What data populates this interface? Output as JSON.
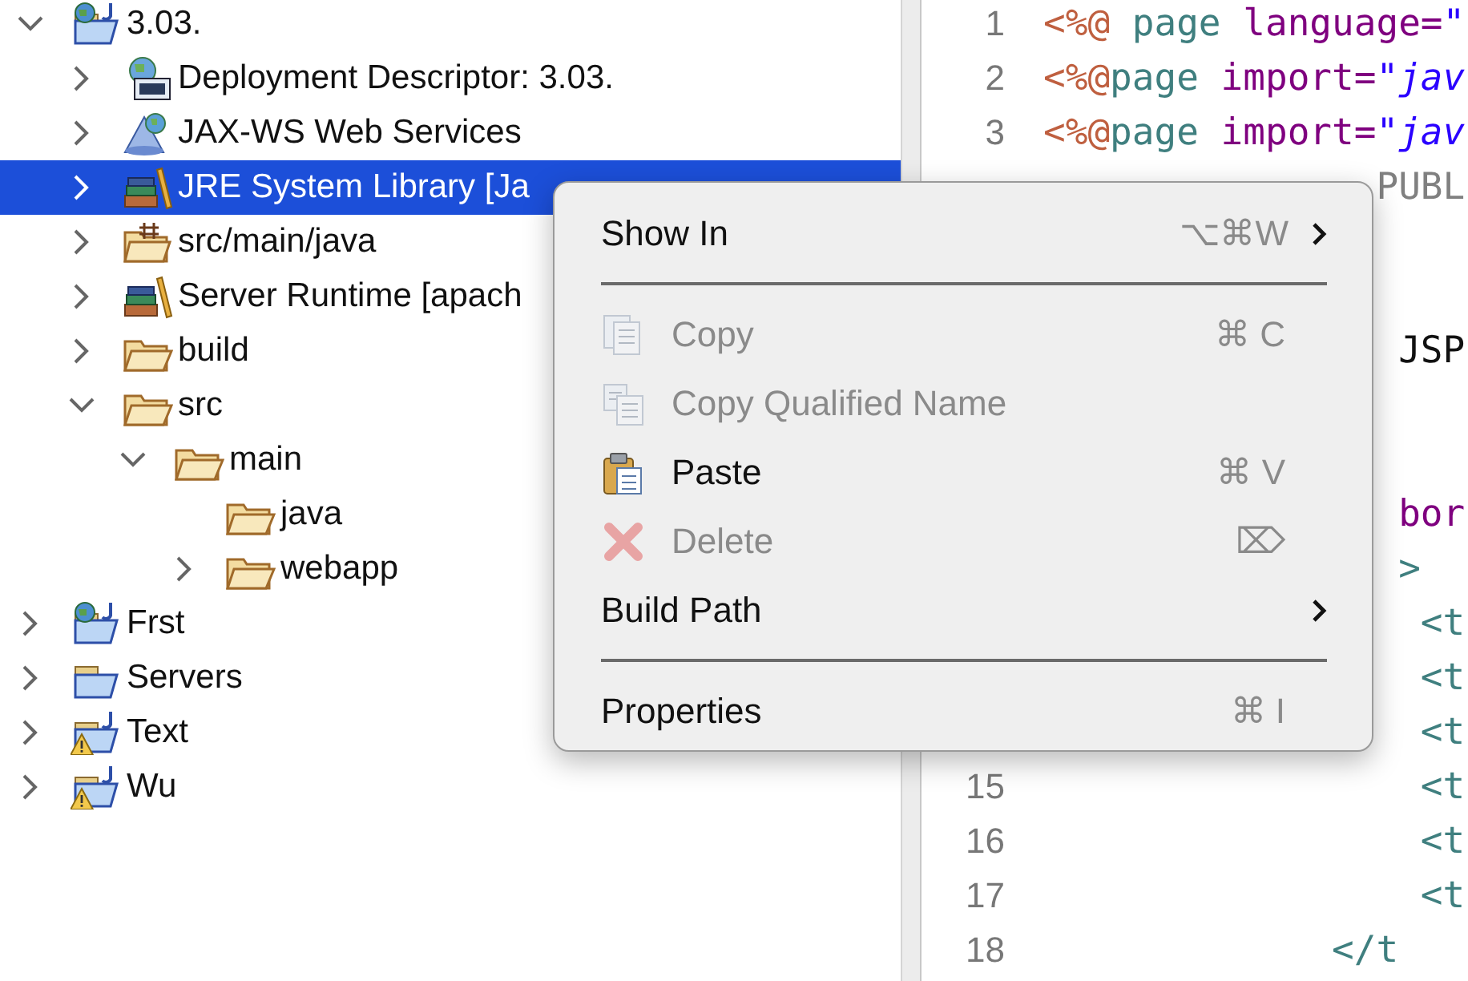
{
  "tree": [
    {
      "label": "3.03.",
      "kind": "web-project",
      "expandable": true,
      "expanded": true,
      "selected": false,
      "children": [
        {
          "label": "Deployment Descriptor: 3.03.",
          "kind": "descriptor",
          "expandable": true,
          "expanded": false,
          "selected": false
        },
        {
          "label": "JAX-WS Web Services",
          "kind": "webservice",
          "expandable": true,
          "expanded": false,
          "selected": false
        },
        {
          "label": "JRE System Library [Ja",
          "kind": "library",
          "expandable": true,
          "expanded": false,
          "selected": true
        },
        {
          "label": "src/main/java",
          "kind": "package-folder",
          "expandable": true,
          "expanded": false,
          "selected": false
        },
        {
          "label": "Server Runtime [apach",
          "kind": "library",
          "expandable": true,
          "expanded": false,
          "selected": false
        },
        {
          "label": "build",
          "kind": "folder",
          "expandable": true,
          "expanded": false,
          "selected": false
        },
        {
          "label": "src",
          "kind": "folder",
          "expandable": true,
          "expanded": true,
          "selected": false,
          "children": [
            {
              "label": "main",
              "kind": "folder",
              "expandable": true,
              "expanded": true,
              "selected": false,
              "children": [
                {
                  "label": "java",
                  "kind": "folder",
                  "expandable": false,
                  "selected": false
                },
                {
                  "label": "webapp",
                  "kind": "folder",
                  "expandable": true,
                  "expanded": false,
                  "selected": false
                }
              ]
            }
          ]
        }
      ]
    },
    {
      "label": "Frst",
      "kind": "web-project",
      "expandable": true,
      "expanded": false,
      "selected": false
    },
    {
      "label": "Servers",
      "kind": "folder-project",
      "expandable": true,
      "expanded": false,
      "selected": false
    },
    {
      "label": "Text",
      "kind": "warning-project",
      "expandable": true,
      "expanded": false,
      "selected": false
    },
    {
      "label": "Wu",
      "kind": "warning-project",
      "expandable": true,
      "expanded": false,
      "selected": false
    }
  ],
  "editor": {
    "lines": [
      {
        "covered": false,
        "number": "1",
        "code": [
          {
            "text": "<%@",
            "kind": "directive"
          },
          {
            "text": " page",
            "kind": "tag"
          },
          {
            "text": " language=",
            "kind": "attr"
          },
          {
            "text": "\"",
            "kind": "string"
          }
        ]
      },
      {
        "covered": false,
        "number": "2",
        "code": [
          {
            "text": "<%@",
            "kind": "directive"
          },
          {
            "text": "page",
            "kind": "tag"
          },
          {
            "text": " import=",
            "kind": "attr"
          },
          {
            "text": "\"jav",
            "kind": "string"
          }
        ]
      },
      {
        "covered": false,
        "number": "3",
        "code": [
          {
            "text": "<%@",
            "kind": "directive"
          },
          {
            "text": "page",
            "kind": "tag"
          },
          {
            "text": " import=",
            "kind": "attr"
          },
          {
            "text": "\"jav",
            "kind": "string"
          }
        ]
      },
      {
        "covered": false,
        "code": [
          {
            "text": "               PUBL",
            "kind": "doctype"
          }
        ]
      },
      {
        "covered": true
      },
      {
        "covered": true
      },
      {
        "covered": false,
        "code": [
          {
            "text": "                JSP",
            "kind": "plain"
          }
        ]
      },
      {
        "covered": true
      },
      {
        "covered": true
      },
      {
        "covered": false,
        "code": [
          {
            "text": "                bor",
            "kind": "attr"
          }
        ]
      },
      {
        "covered": false,
        "code": [
          {
            "text": "                >",
            "kind": "tag"
          }
        ]
      },
      {
        "covered": false,
        "code": [
          {
            "text": "                 <t",
            "kind": "tag"
          }
        ]
      },
      {
        "covered": false,
        "code": [
          {
            "text": "                 <t",
            "kind": "tag"
          }
        ]
      },
      {
        "covered": false,
        "code": [
          {
            "text": "                 <t",
            "kind": "tag"
          }
        ]
      },
      {
        "covered": false,
        "number": "15",
        "code": [
          {
            "text": "                 <t",
            "kind": "tag"
          }
        ]
      },
      {
        "covered": false,
        "number": "16",
        "code": [
          {
            "text": "                 <t",
            "kind": "tag"
          }
        ]
      },
      {
        "covered": false,
        "number": "17",
        "code": [
          {
            "text": "                 <t",
            "kind": "tag"
          }
        ]
      },
      {
        "covered": false,
        "number": "18",
        "code": [
          {
            "text": "             </t",
            "kind": "tag"
          }
        ]
      }
    ]
  },
  "context_menu": {
    "items": [
      {
        "kind": "plain",
        "label": "Show In",
        "shortcut": "⌥⌘W",
        "submenu": true,
        "disabled": false
      },
      {
        "kind": "separator"
      },
      {
        "kind": "copy",
        "label": "Copy",
        "shortcut": "⌘ C",
        "submenu": false,
        "disabled": true
      },
      {
        "kind": "copy-name",
        "label": "Copy Qualified Name",
        "submenu": false,
        "disabled": true
      },
      {
        "kind": "paste",
        "label": "Paste",
        "shortcut": "⌘ V",
        "submenu": false,
        "disabled": false
      },
      {
        "kind": "delete",
        "label": "Delete",
        "shortcut": "⌦",
        "submenu": false,
        "disabled": true
      },
      {
        "kind": "plain",
        "label": "Build Path",
        "submenu": true,
        "disabled": false
      },
      {
        "kind": "separator"
      },
      {
        "kind": "plain",
        "label": "Properties",
        "shortcut": "⌘ I",
        "submenu": false,
        "disabled": false
      }
    ]
  }
}
